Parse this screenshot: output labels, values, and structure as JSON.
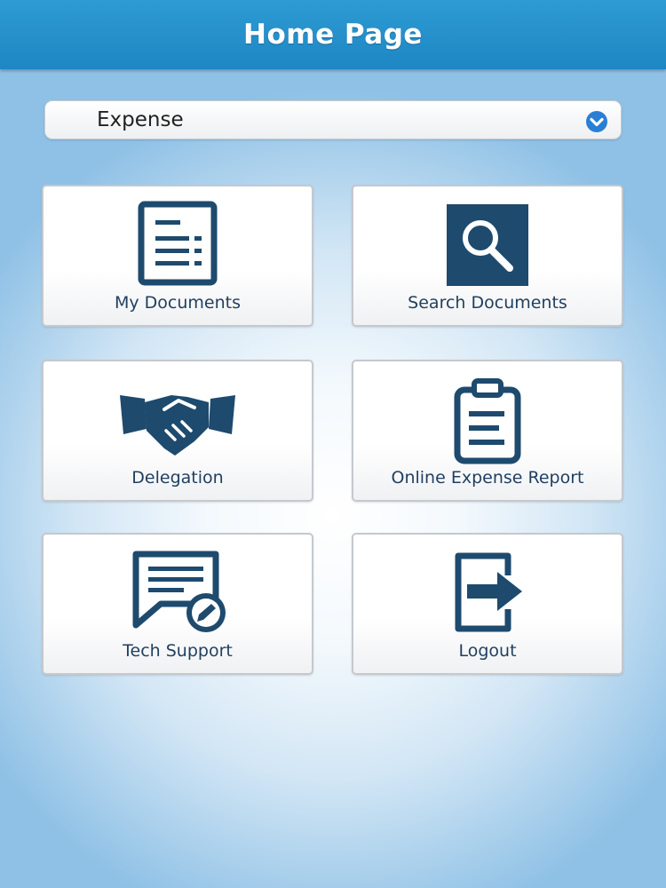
{
  "header": {
    "title": "Home Page"
  },
  "selector": {
    "value": "Expense",
    "icon": "chevron-down-icon"
  },
  "colors": {
    "header": "#1d86c3",
    "icon": "#1e4a6e",
    "select_chevron": "#2a7fd4"
  },
  "tiles": [
    {
      "label": "My Documents",
      "icon": "document-list-icon"
    },
    {
      "label": "Search Documents",
      "icon": "search-icon"
    },
    {
      "label": "Delegation",
      "icon": "handshake-icon"
    },
    {
      "label": "Online Expense Report",
      "icon": "clipboard-icon"
    },
    {
      "label": "Tech Support",
      "icon": "support-chat-icon"
    },
    {
      "label": "Logout",
      "icon": "logout-icon"
    }
  ]
}
